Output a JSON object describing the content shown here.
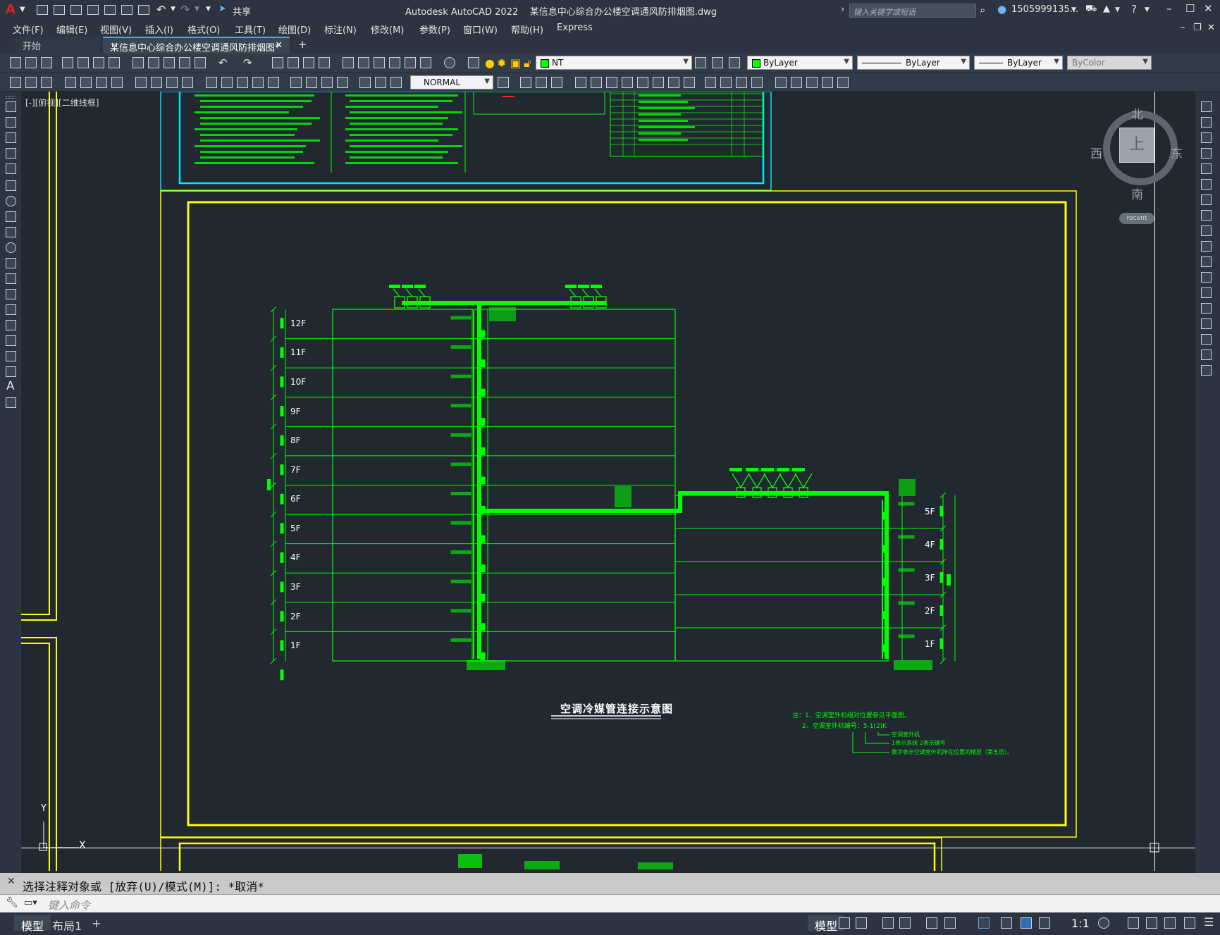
{
  "app": {
    "title": "Autodesk AutoCAD 2022",
    "filename": "某信息中心综合办公楼空调通风防排烟图.dwg",
    "share_label": "共享",
    "search_placeholder": "键入关键字或短语",
    "user": "1505999135...",
    "logo": "A"
  },
  "menu": [
    "文件(F)",
    "编辑(E)",
    "视图(V)",
    "插入(I)",
    "格式(O)",
    "工具(T)",
    "绘图(D)",
    "标注(N)",
    "修改(M)",
    "参数(P)",
    "窗口(W)",
    "帮助(H)",
    "Express"
  ],
  "tabs": {
    "start": "开始",
    "active": "某信息中心综合办公楼空调通风防排烟图*",
    "add": "+"
  },
  "toolbar": {
    "layer": "NT",
    "color": "ByLayer",
    "linetype": "ByLayer",
    "lineweight": "ByLayer",
    "plotstyle": "ByColor",
    "dimstyle": "NORMAL"
  },
  "viewport_label": "[-][俯视][二维线框]",
  "viewcube": {
    "north": "北",
    "south": "南",
    "east": "东",
    "west": "西",
    "face": "上",
    "recent": "recent"
  },
  "drawing": {
    "title": "空调冷媒管连接示意图",
    "floors_left": [
      "12F",
      "11F",
      "10F",
      "9F",
      "8F",
      "7F",
      "6F",
      "5F",
      "4F",
      "3F",
      "2F",
      "1F"
    ],
    "floors_right": [
      "5F",
      "4F",
      "3F",
      "2F",
      "1F"
    ],
    "notes": [
      "注：1、空调室外机组对位置参见平面图。",
      "2、空调室外机编号：5-1(2)K",
      "空调室外机",
      "1表示系统  2表示编号",
      "数字表示空调室外机所在位置的楼层（第五层）。"
    ],
    "ucs_y": "Y",
    "ucs_x": "X"
  },
  "command": {
    "history": "选择注释对象或 [放弃(U)/模式(M)]: *取消*",
    "placeholder": "键入命令"
  },
  "status": {
    "model": "模型",
    "layout": "布局1",
    "add": "+",
    "scale": "1:1"
  },
  "colors": {
    "drawing_green": "#00ff00",
    "frame_yellow": "#ffff00",
    "frame_cyan": "#00e5ff",
    "background": "#212830"
  }
}
